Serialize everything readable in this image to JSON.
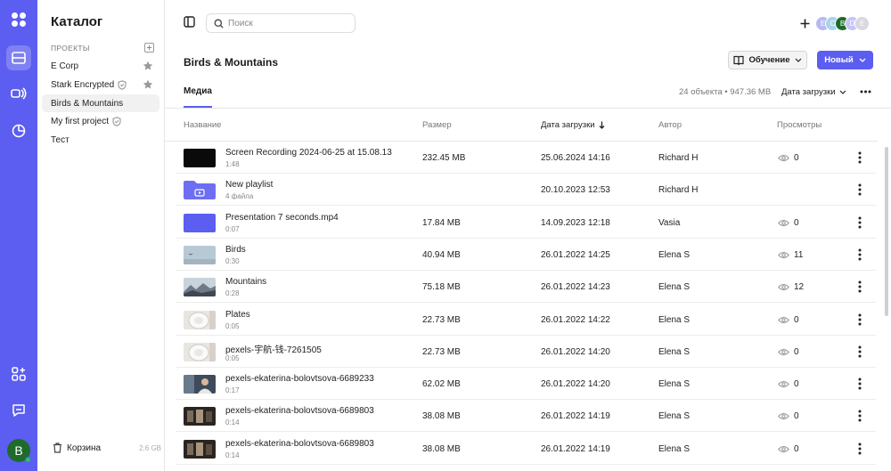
{
  "sidebar": {
    "title": "Каталог",
    "section_label": "ПРОЕКТЫ",
    "projects": [
      {
        "label": "E Corp",
        "icon": "star-icon"
      },
      {
        "label": "Stark Encrypted",
        "icon": "star-icon"
      },
      {
        "label": "Birds & Mountains",
        "icon": ""
      },
      {
        "label": "My first project",
        "icon": "shield-icon"
      },
      {
        "label": "Тест",
        "icon": ""
      }
    ],
    "trash_label": "Корзина",
    "trash_size": "2.6 GB"
  },
  "rail": {
    "avatar_letter": "B"
  },
  "header": {
    "search_placeholder": "Поиск",
    "collaborators": [
      "E",
      "C",
      "B",
      "D",
      "E"
    ]
  },
  "page": {
    "title": "Birds & Mountains",
    "learn_label": "Обучение",
    "new_label": "Новый",
    "tab_media": "Медиа",
    "count": "24 объекта • 947.36 MB",
    "sort_label": "Дата загрузки"
  },
  "table": {
    "columns": {
      "name": "Название",
      "size": "Размер",
      "date": "Дата загрузки",
      "author": "Автор",
      "views": "Просмотры"
    },
    "rows": [
      {
        "name": "Screen Recording 2024-06-25 at 15.08.13",
        "sub": "1:48",
        "size": "232.45 MB",
        "date": "25.06.2024 14:16",
        "author": "Richard H",
        "views": "0",
        "thumb": "black"
      },
      {
        "name": "New playlist",
        "sub": "4 файла",
        "size": "",
        "date": "20.10.2023 12:53",
        "author": "Richard H",
        "views": "",
        "thumb": "folder"
      },
      {
        "name": "Presentation 7 seconds.mp4",
        "sub": "0:07",
        "size": "17.84 MB",
        "date": "14.09.2023 12:18",
        "author": "Vasia",
        "views": "0",
        "thumb": "purple"
      },
      {
        "name": "Birds",
        "sub": "0:30",
        "size": "40.94 MB",
        "date": "26.01.2022 14:25",
        "author": "Elena S",
        "views": "11",
        "thumb": "sky"
      },
      {
        "name": "Mountains",
        "sub": "0:28",
        "size": "75.18 MB",
        "date": "26.01.2022 14:23",
        "author": "Elena S",
        "views": "12",
        "thumb": "mountain"
      },
      {
        "name": "Plates",
        "sub": "0:05",
        "size": "22.73 MB",
        "date": "26.01.2022 14:22",
        "author": "Elena S",
        "views": "0",
        "thumb": "plate"
      },
      {
        "name": "pexels-宇航-钱-7261505",
        "sub": "0:05",
        "size": "22.73 MB",
        "date": "26.01.2022 14:20",
        "author": "Elena S",
        "views": "0",
        "thumb": "plate"
      },
      {
        "name": "pexels-ekaterina-bolovtsova-6689233",
        "sub": "0:17",
        "size": "62.02 MB",
        "date": "26.01.2022 14:20",
        "author": "Elena S",
        "views": "0",
        "thumb": "person"
      },
      {
        "name": "pexels-ekaterina-bolovtsova-6689803",
        "sub": "0:14",
        "size": "38.08 MB",
        "date": "26.01.2022 14:19",
        "author": "Elena S",
        "views": "0",
        "thumb": "dark"
      },
      {
        "name": "pexels-ekaterina-bolovtsova-6689803",
        "sub": "0:14",
        "size": "38.08 MB",
        "date": "26.01.2022 14:19",
        "author": "Elena S",
        "views": "0",
        "thumb": "dark"
      }
    ]
  },
  "colors": {
    "accent": "#5b5ef0",
    "rail": "#5b5ef0",
    "avatar": "#1f6b2b"
  }
}
